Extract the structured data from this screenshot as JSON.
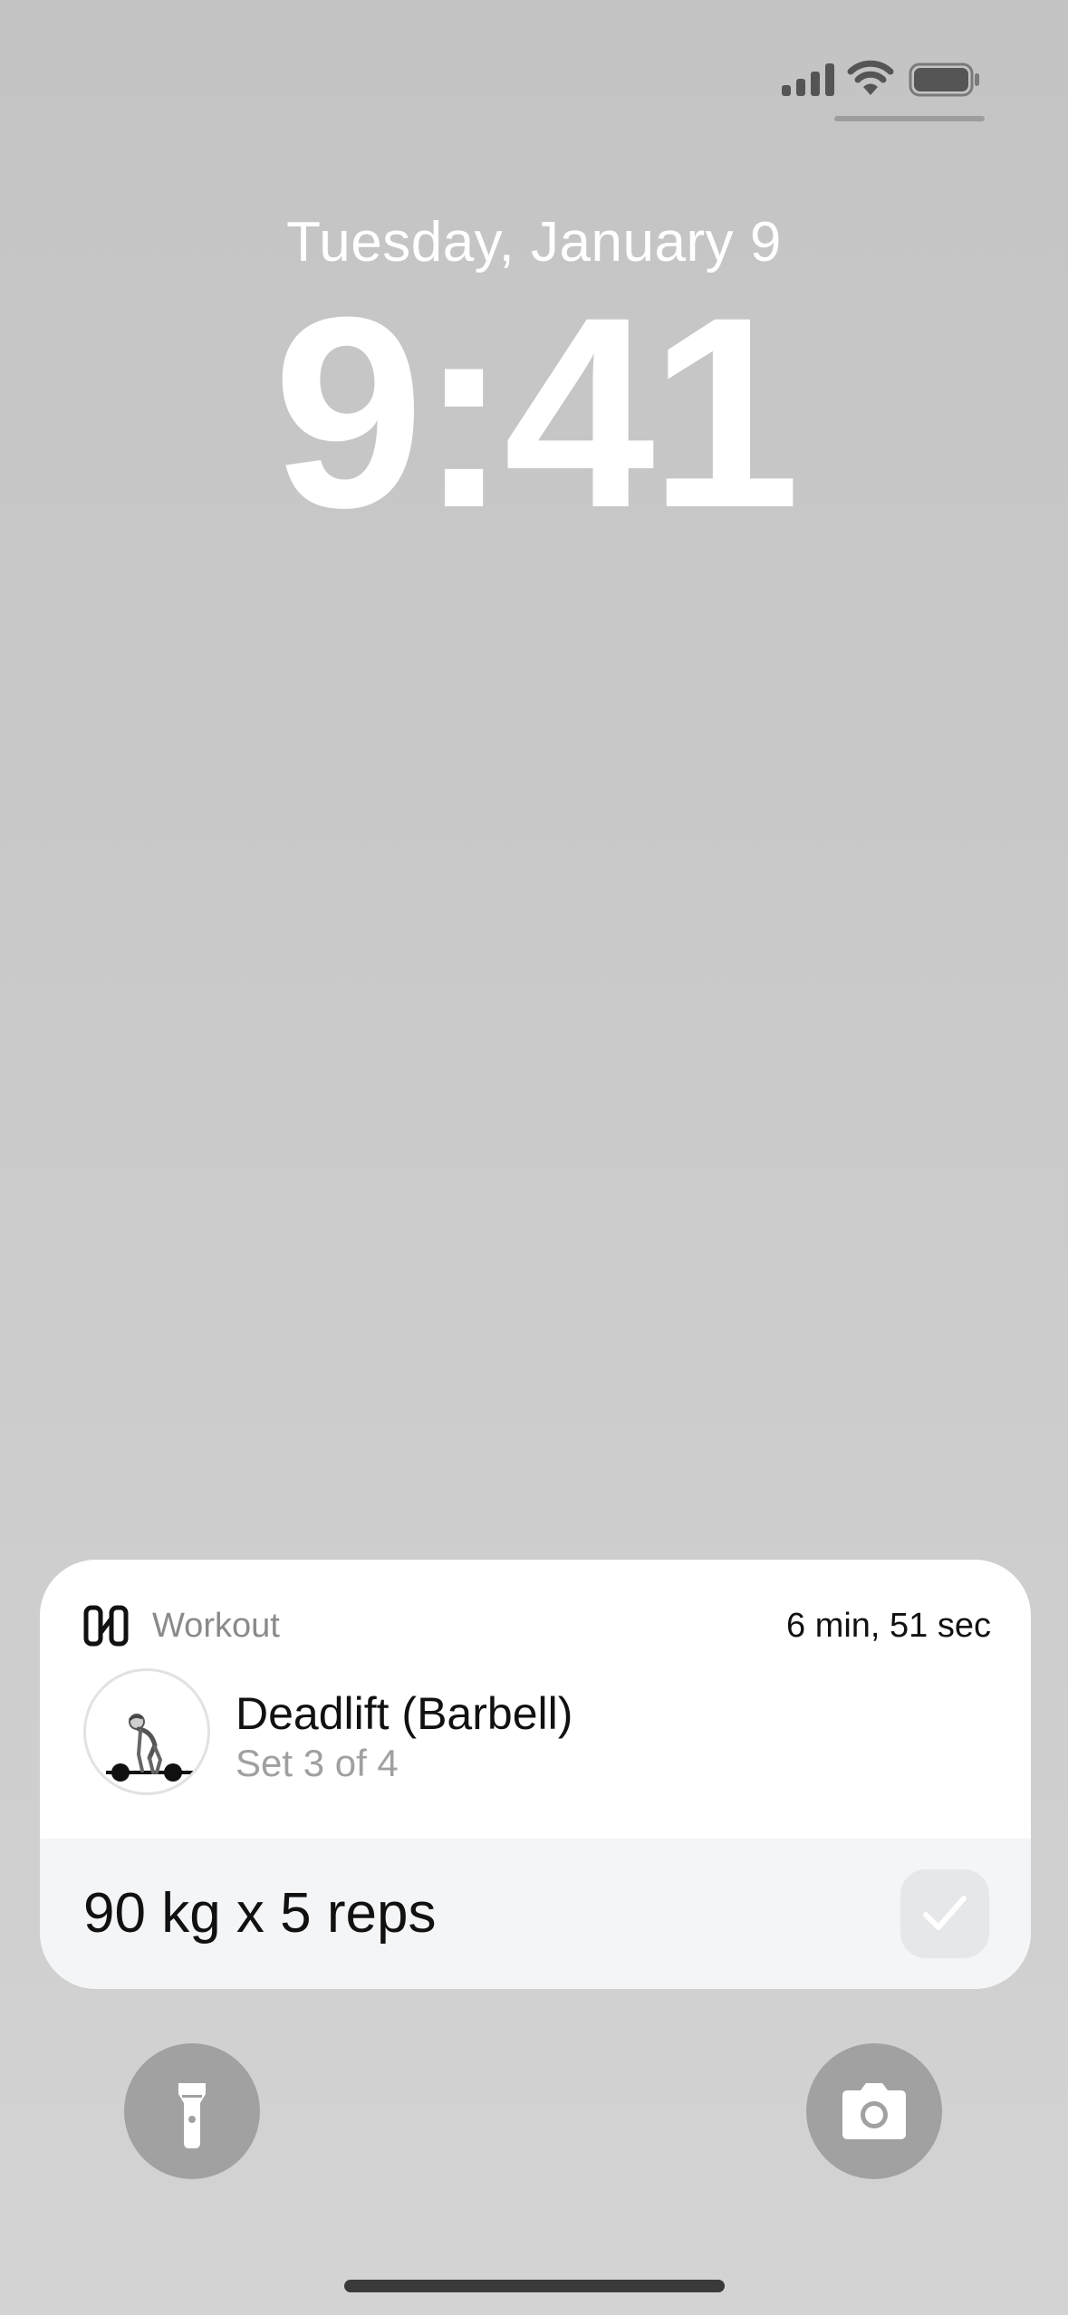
{
  "status_bar": {
    "signal_icon": "cellular-signal-icon",
    "wifi_icon": "wifi-icon",
    "battery_icon": "battery-icon"
  },
  "lock_screen": {
    "date": "Tuesday, January 9",
    "time": "9:41"
  },
  "live_activity": {
    "app_icon": "app-logo-icon",
    "app_name": "Workout",
    "elapsed": "6 min, 51 sec",
    "exercise": {
      "name": "Deadlift (Barbell)",
      "progress": "Set 3 of 4",
      "thumbnail_icon": "deadlift-illustration"
    },
    "set": {
      "detail": "90 kg x 5 reps",
      "complete_icon": "checkmark-icon"
    }
  },
  "quick_actions": {
    "left_icon": "flashlight-icon",
    "right_icon": "camera-icon"
  },
  "colors": {
    "text_primary": "#111111",
    "text_secondary": "#8a8a8a",
    "card_background": "#ffffff",
    "set_row_background": "#f4f5f7",
    "quick_button_background": "#a1a1a1"
  }
}
